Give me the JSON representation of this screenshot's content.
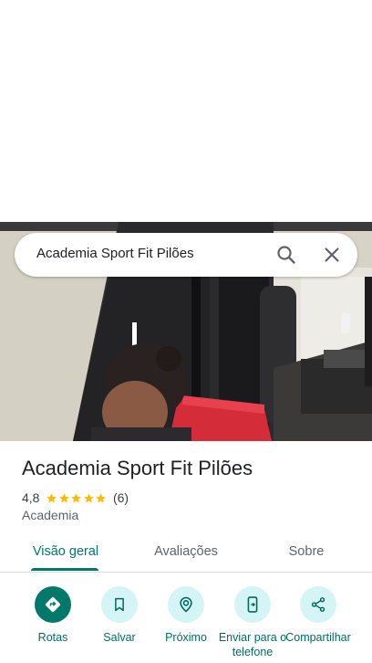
{
  "search": {
    "query": "Academia Sport Fit Pilões"
  },
  "place": {
    "name": "Academia Sport Fit Pilões",
    "rating": "4,8",
    "rating_stars": 5,
    "review_count": "(6)",
    "category": "Academia"
  },
  "tabs": [
    {
      "label": "Visão geral",
      "active": true
    },
    {
      "label": "Avaliações",
      "active": false
    },
    {
      "label": "Sobre",
      "active": false
    }
  ],
  "actions": [
    {
      "label": "Rotas",
      "icon": "directions-icon"
    },
    {
      "label": "Salvar",
      "icon": "bookmark-icon"
    },
    {
      "label": "Próximo",
      "icon": "nearby-icon"
    },
    {
      "label": "Enviar para o telefone",
      "icon": "send-to-phone-icon"
    },
    {
      "label": "Compartilhar",
      "icon": "share-icon"
    }
  ],
  "colors": {
    "accent": "#00796b",
    "action_bg": "#d5f4f6",
    "star": "#fbbc04"
  }
}
